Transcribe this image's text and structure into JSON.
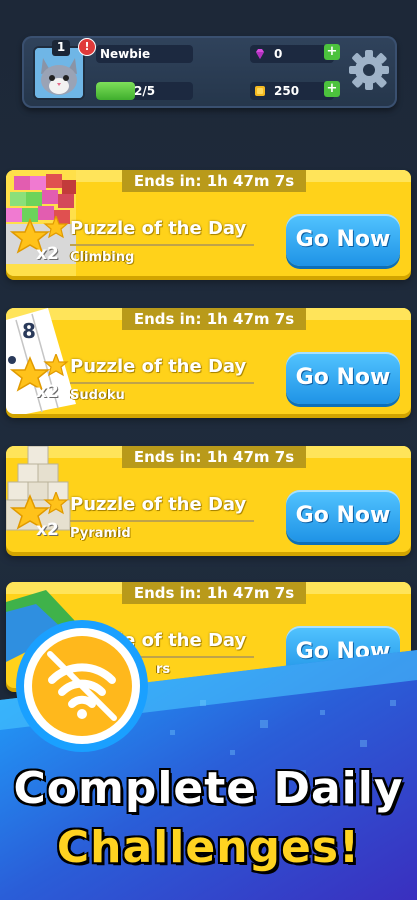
{
  "header": {
    "level": "1",
    "alert": "!",
    "name": "Newbie",
    "xp_text": "2/5",
    "xp_progress": 0.4,
    "gems": "0",
    "coins": "250",
    "plus": "+",
    "icons": [
      "avatar-cat",
      "gem-icon",
      "coin-icon",
      "gear-icon",
      "plus-icon"
    ]
  },
  "cards": [
    {
      "ends": "Ends in: 1h 47m 7s",
      "title": "Puzzle of the Day",
      "subtitle": "Climbing",
      "multiplier": "x2",
      "button": "Go Now"
    },
    {
      "ends": "Ends in: 1h 47m 7s",
      "title": "Puzzle of the Day",
      "subtitle": "Sudoku",
      "multiplier": "x2",
      "button": "Go Now"
    },
    {
      "ends": "Ends in: 1h 47m 7s",
      "title": "Puzzle of the Day",
      "subtitle": "Pyramid",
      "multiplier": "x2",
      "button": "Go Now"
    },
    {
      "ends": "Ends in: 1h 47m 7s",
      "title": "Puzzle of the Day",
      "subtitle": "rs",
      "multiplier": "",
      "button": "Go Now"
    }
  ],
  "promo": {
    "line1": "Complete Daily",
    "line2": "Challenges!",
    "icon": "no-wifi-icon"
  },
  "colors": {
    "card_yellow": "#ffd21a",
    "button_blue": "#1f93e6",
    "cta_yellow": "#ffd321",
    "bg_dark": "#1e2a3a"
  }
}
